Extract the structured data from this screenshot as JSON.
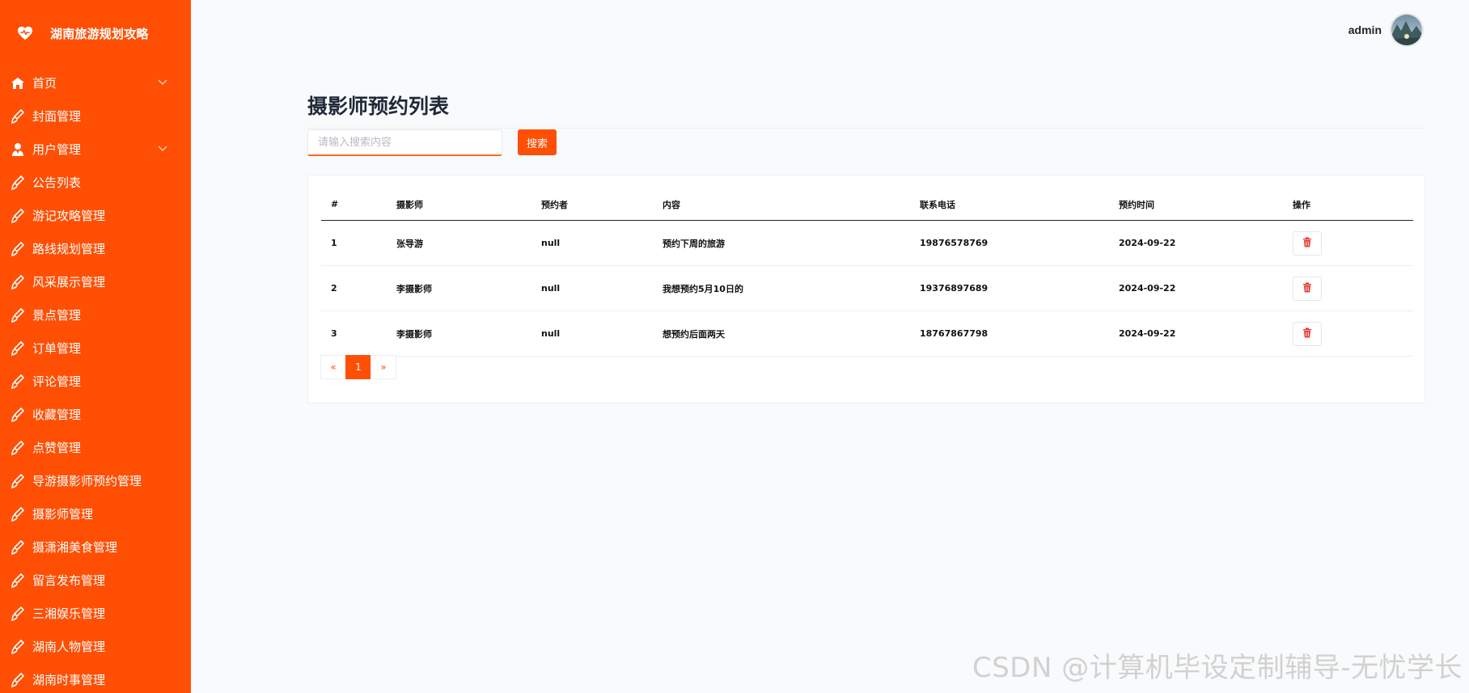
{
  "brand": {
    "title": "湖南旅游规划攻略",
    "icon": "heart-pulse-icon"
  },
  "sidebar": {
    "items": [
      {
        "label": "首页",
        "icon": "home-icon",
        "expandable": true
      },
      {
        "label": "封面管理",
        "icon": "brush-icon"
      },
      {
        "label": "用户管理",
        "icon": "user-icon",
        "expandable": true
      },
      {
        "label": "公告列表",
        "icon": "brush-icon"
      },
      {
        "label": "游记攻略管理",
        "icon": "brush-icon"
      },
      {
        "label": "路线规划管理",
        "icon": "brush-icon"
      },
      {
        "label": "风采展示管理",
        "icon": "brush-icon"
      },
      {
        "label": "景点管理",
        "icon": "brush-icon"
      },
      {
        "label": "订单管理",
        "icon": "brush-icon"
      },
      {
        "label": "评论管理",
        "icon": "brush-icon"
      },
      {
        "label": "收藏管理",
        "icon": "brush-icon"
      },
      {
        "label": "点赞管理",
        "icon": "brush-icon"
      },
      {
        "label": "导游摄影师预约管理",
        "icon": "brush-icon"
      },
      {
        "label": "摄影师管理",
        "icon": "brush-icon"
      },
      {
        "label": "摄潇湘美食管理",
        "icon": "brush-icon"
      },
      {
        "label": "留言发布管理",
        "icon": "brush-icon"
      },
      {
        "label": "三湘娱乐管理",
        "icon": "brush-icon"
      },
      {
        "label": "湖南人物管理",
        "icon": "brush-icon"
      },
      {
        "label": "湖南时事管理",
        "icon": "brush-icon"
      }
    ]
  },
  "header": {
    "username": "admin"
  },
  "main": {
    "title": "摄影师预约列表",
    "search": {
      "placeholder": "请输入搜索内容",
      "value": "",
      "button_label": "搜索"
    },
    "table": {
      "columns": [
        "#",
        "摄影师",
        "预约者",
        "内容",
        "联系电话",
        "预约时间",
        "操作"
      ],
      "rows": [
        {
          "id": "1",
          "photographer": "张导游",
          "booker": "null",
          "content": "预约下周的旅游",
          "phone": "19876578769",
          "time": "2024-09-22"
        },
        {
          "id": "2",
          "photographer": "李摄影师",
          "booker": "null",
          "content": "我想预约5月10日的",
          "phone": "19376897689",
          "time": "2024-09-22"
        },
        {
          "id": "3",
          "photographer": "李摄影师",
          "booker": "null",
          "content": "想预约后面两天",
          "phone": "18767867798",
          "time": "2024-09-22"
        }
      ]
    },
    "pagination": {
      "prev": "«",
      "current": "1",
      "next": "»"
    }
  },
  "watermark": "CSDN @计算机毕设定制辅导-无忧学长",
  "colors": {
    "accent": "#ff4f04",
    "danger": "#e53935",
    "background": "#f9fafb"
  }
}
